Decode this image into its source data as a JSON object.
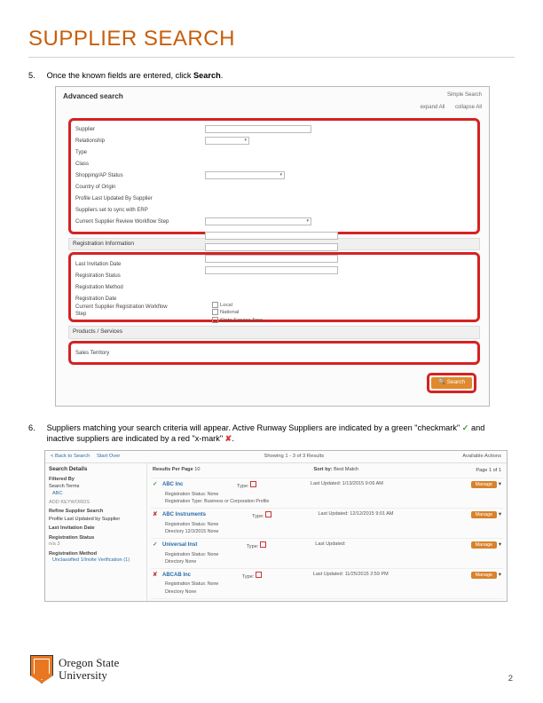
{
  "page_title": "SUPPLIER SEARCH",
  "page_number": "2",
  "steps": {
    "s5": {
      "num": "5.",
      "text_a": "Once the known fields are entered, click ",
      "text_b": "Search",
      "text_c": "."
    },
    "s6": {
      "num": "6.",
      "text_a": "Suppliers matching your search criteria will appear. Active Runway Suppliers are indicated by a green \"checkmark\" ",
      "text_b": " and inactive suppliers are indicated by a red \"x-mark\" ",
      "text_c": "."
    }
  },
  "shot1": {
    "title": "Advanced search",
    "simple": "Simple Search",
    "links": {
      "expand": "expand All",
      "collapse": "collapse All"
    },
    "supplier_labels": [
      "Supplier",
      "Relationship",
      "Type",
      "Class",
      "Shopping/AP Status",
      "Country of Origin",
      "Profile Last Updated By Supplier",
      "Suppliers set to sync with ERP",
      "Current Supplier Review Workflow Step"
    ],
    "sections": {
      "reg": "Registration Information",
      "prod": "Products / Services"
    },
    "reg_labels": [
      "Last Invitation Date",
      "Registration Status",
      "Registration Method",
      "Registration Date",
      "Current Supplier Registration Workflow Step"
    ],
    "prod_labels": [
      "Sales Territory"
    ],
    "prod_opts": [
      "Local",
      "National",
      "State Service Area"
    ],
    "search_btn": "Search"
  },
  "shot2": {
    "back": "< Back to Search",
    "startover": "Start Over",
    "showing": "Showing 1 - 3 of 3 Results",
    "sort": {
      "lbl": "Sort by:",
      "val": "Best Match"
    },
    "resultsper": {
      "lbl": "Results Per Page",
      "val": "10"
    },
    "side": {
      "title": "Search Details",
      "filtered": "Filtered By",
      "filter1_lbl": "Search Terms",
      "filter1_val": "ABC",
      "addkw": "ADD KEYWORDS",
      "refine": "Refine Supplier Search",
      "profile_lbl": "Profile Last Updated by Supplier",
      "lastinv": "Last Invitation Date",
      "regstat": "Registration Status",
      "regmeth": "Registration Method",
      "regmeth_val": "Unclassified 1/Invite Verification (1)"
    },
    "type_lbl": "Type:",
    "lu_lbl": "Last Updated:",
    "manage": "Manage",
    "results": [
      {
        "ok": true,
        "name": "ABC Inc",
        "sub": "Registration Status: None",
        "sub2": "Registration Type: Business or Corporation Profile",
        "type": "",
        "lu": "1/13/2015 9:06 AM"
      },
      {
        "ok": false,
        "name": "ABC Instruments",
        "sub": "Registration Status: None",
        "sub2": "",
        "type": "Directory 12/3/2015 None",
        "lu": "12/12/2015 9:01 AM"
      },
      {
        "ok": true,
        "name": "Universal Inst",
        "sub": "Registration Status: None",
        "sub2": "",
        "type": "Directory None",
        "lu": ""
      },
      {
        "ok": false,
        "name": "ABCAB Inc",
        "sub": "Registration Status: None",
        "sub2": "",
        "type": "Directory None",
        "lu": "11/25/2015 2:59 PM"
      }
    ],
    "page": "Page 1 of 1",
    "avail": "Available Actions"
  },
  "university": {
    "l1": "Oregon State",
    "l2": "University"
  }
}
